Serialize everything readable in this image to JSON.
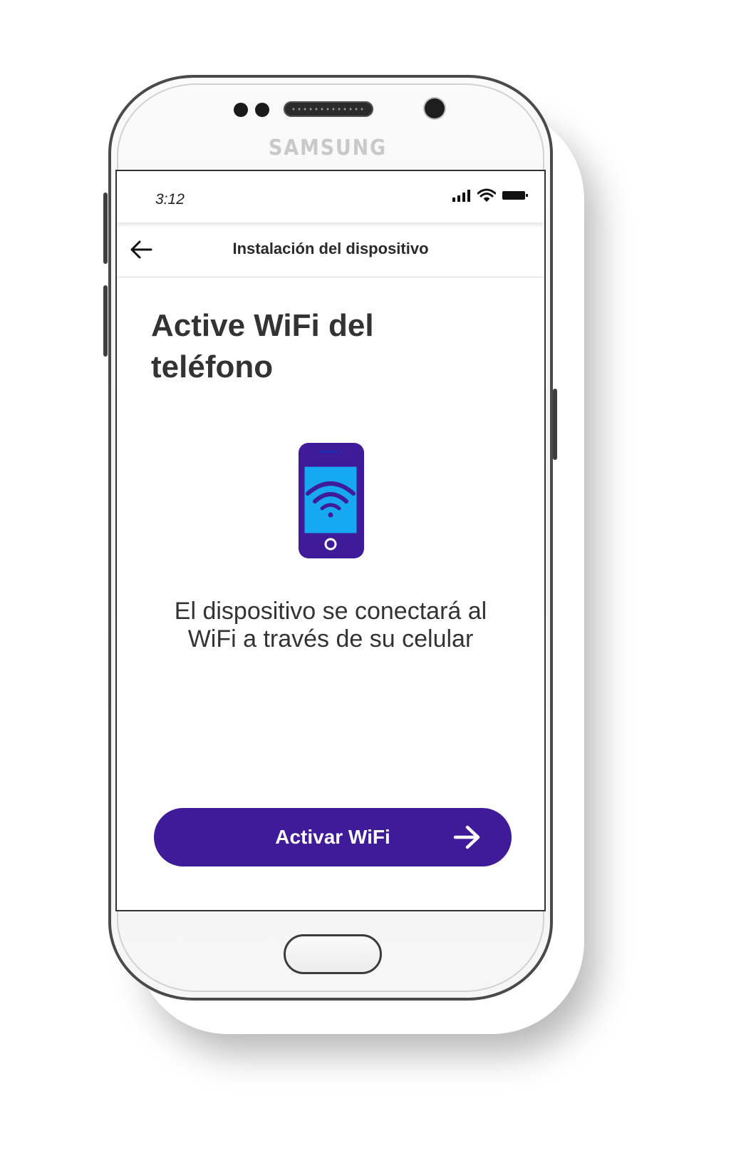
{
  "device": {
    "brand": "SAMSUNG"
  },
  "status_bar": {
    "time": "3:12",
    "icons": [
      "signal-icon",
      "wifi-icon",
      "battery-icon"
    ]
  },
  "header": {
    "back_icon": "arrow-left-icon",
    "title": "Instalación del dispositivo"
  },
  "main": {
    "title": "Active WiFi del teléfono",
    "illustration_icon": "phone-wifi-icon",
    "description": "El dispositivo se conectará al WiFi a través de su celular"
  },
  "cta": {
    "label": "Activar WiFi",
    "icon": "arrow-right-icon"
  },
  "colors": {
    "primary": "#3f1a99",
    "illustration_screen": "#16a8f0",
    "text": "#333333"
  }
}
